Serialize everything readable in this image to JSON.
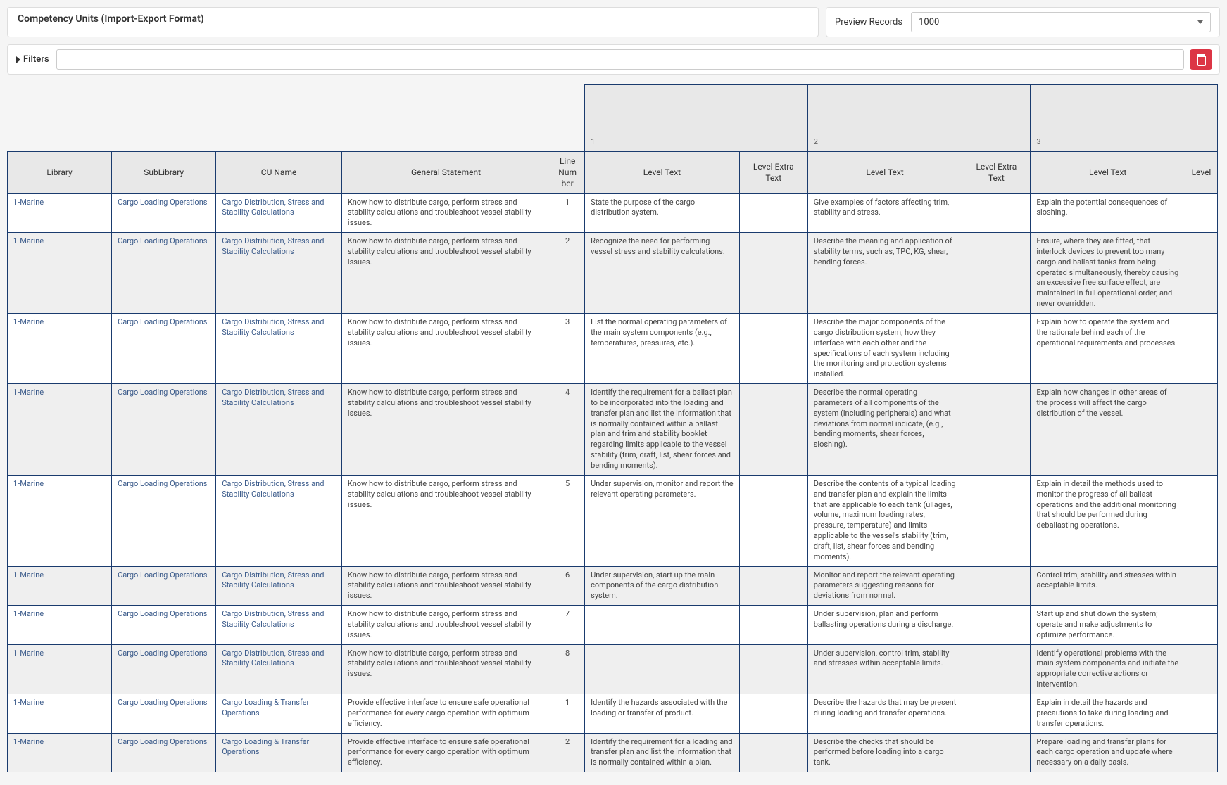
{
  "header": {
    "title": "Competency Units (Import-Export Format)"
  },
  "preview": {
    "label": "Preview Records",
    "value": "1000"
  },
  "filters": {
    "label": "Filters",
    "input_value": ""
  },
  "columns": {
    "library": "Library",
    "sublibrary": "SubLibrary",
    "cu_name": "CU Name",
    "general": "General Statement",
    "line_no": "Line Number",
    "level_text": "Level Text",
    "level_extra": "Level Extra Text",
    "level": "Level"
  },
  "super_headers": [
    "1",
    "2",
    "3"
  ],
  "rows": [
    {
      "lib": "1-Marine",
      "sub": "Cargo Loading Operations",
      "cu": "Cargo Distribution, Stress and Stability Calculations",
      "gen": "Know how to distribute cargo, perform stress and stability calculations and troubleshoot vessel stability issues.",
      "line": "1",
      "l1t": "State the purpose of the cargo distribution system.",
      "l1e": "",
      "l2t": "Give examples of factors affecting trim, stability and stress.",
      "l2e": "",
      "l3t": "Explain the potential consequences of sloshing.",
      "lev": ""
    },
    {
      "lib": "1-Marine",
      "sub": "Cargo Loading Operations",
      "cu": "Cargo Distribution, Stress and Stability Calculations",
      "gen": "Know how to distribute cargo, perform stress and stability calculations and troubleshoot vessel stability issues.",
      "line": "2",
      "l1t": "Recognize the need for performing vessel stress and stability calculations.",
      "l1e": "",
      "l2t": "Describe the meaning and application of stability terms, such as, TPC, KG, shear, bending forces.",
      "l2e": "",
      "l3t": "Ensure, where they are fitted, that interlock devices to prevent too many cargo and ballast tanks from being operated simultaneously, thereby causing an excessive free surface effect, are maintained in full operational order, and never overridden.",
      "lev": ""
    },
    {
      "lib": "1-Marine",
      "sub": "Cargo Loading Operations",
      "cu": "Cargo Distribution, Stress and Stability Calculations",
      "gen": "Know how to distribute cargo, perform stress and stability calculations and troubleshoot vessel stability issues.",
      "line": "3",
      "l1t": "List the normal operating parameters of the main system components (e.g., temperatures, pressures, etc.).",
      "l1e": "",
      "l2t": "Describe the major components of the cargo distribution system, how they interface with each other and the specifications of each system including the monitoring and protection systems installed.",
      "l2e": "",
      "l3t": "Explain how to operate the system and the rationale behind each of the operational requirements and processes.",
      "lev": ""
    },
    {
      "lib": "1-Marine",
      "sub": "Cargo Loading Operations",
      "cu": "Cargo Distribution, Stress and Stability Calculations",
      "gen": "Know how to distribute cargo, perform stress and stability calculations and troubleshoot vessel stability issues.",
      "line": "4",
      "l1t": "Identify the requirement for a ballast plan to be incorporated into the loading and transfer plan and list the information that is normally contained within a ballast plan and trim and stability booklet regarding limits applicable to the vessel stability (trim, draft, list, shear forces and bending moments).",
      "l1e": "",
      "l2t": "Describe the normal operating parameters of all components of the system (including peripherals) and what deviations from normal indicate, (e.g., bending moments, shear forces, sloshing).",
      "l2e": "",
      "l3t": "Explain how changes in other areas of the process will affect the cargo distribution of the vessel.",
      "lev": ""
    },
    {
      "lib": "1-Marine",
      "sub": "Cargo Loading Operations",
      "cu": "Cargo Distribution, Stress and Stability Calculations",
      "gen": "Know how to distribute cargo, perform stress and stability calculations and troubleshoot vessel stability issues.",
      "line": "5",
      "l1t": "Under supervision, monitor and report the relevant operating parameters.",
      "l1e": "",
      "l2t": "Describe the contents of a typical loading and transfer plan and explain the limits that are applicable to each tank (ullages, volume, maximum loading rates, pressure, temperature) and limits applicable to the vessel's stability (trim, draft, list, shear forces and bending moments).",
      "l2e": "",
      "l3t": "Explain in detail the methods used to monitor the progress of all ballast operations and the additional monitoring that should be performed during deballasting operations.",
      "lev": ""
    },
    {
      "lib": "1-Marine",
      "sub": "Cargo Loading Operations",
      "cu": "Cargo Distribution, Stress and Stability Calculations",
      "gen": "Know how to distribute cargo, perform stress and stability calculations and troubleshoot vessel stability issues.",
      "line": "6",
      "l1t": "Under supervision, start up the main components of the cargo distribution system.",
      "l1e": "",
      "l2t": "Monitor and report the relevant operating parameters suggesting reasons for deviations from normal.",
      "l2e": "",
      "l3t": "Control trim, stability and stresses within acceptable limits.",
      "lev": ""
    },
    {
      "lib": "1-Marine",
      "sub": "Cargo Loading Operations",
      "cu": "Cargo Distribution, Stress and Stability Calculations",
      "gen": "Know how to distribute cargo, perform stress and stability calculations and troubleshoot vessel stability issues.",
      "line": "7",
      "l1t": "",
      "l1e": "",
      "l2t": "Under supervision, plan and perform ballasting operations during a discharge.",
      "l2e": "",
      "l3t": "Start up and shut down the system; operate and make adjustments to optimize performance.",
      "lev": ""
    },
    {
      "lib": "1-Marine",
      "sub": "Cargo Loading Operations",
      "cu": "Cargo Distribution, Stress and Stability Calculations",
      "gen": "Know how to distribute cargo, perform stress and stability calculations and troubleshoot vessel stability issues.",
      "line": "8",
      "l1t": "",
      "l1e": "",
      "l2t": "Under supervision, control trim, stability and stresses within acceptable limits.",
      "l2e": "",
      "l3t": "Identify operational problems with the main system components and initiate the appropriate corrective actions or intervention.",
      "lev": ""
    },
    {
      "lib": "1-Marine",
      "sub": "Cargo Loading Operations",
      "cu": "Cargo Loading & Transfer Operations",
      "gen": "Provide effective interface to ensure safe operational performance for every cargo operation with optimum efficiency.",
      "line": "1",
      "l1t": "Identify the hazards associated with the loading or transfer of product.",
      "l1e": "",
      "l2t": "Describe the hazards that may be present during loading and transfer operations.",
      "l2e": "",
      "l3t": "Explain in detail the hazards and precautions to take during loading and transfer operations.",
      "lev": ""
    },
    {
      "lib": "1-Marine",
      "sub": "Cargo Loading Operations",
      "cu": "Cargo Loading & Transfer Operations",
      "gen": "Provide effective interface to ensure safe operational performance for every cargo operation with optimum efficiency.",
      "line": "2",
      "l1t": "Identify the requirement for a loading and transfer plan and list the information that is normally contained within a plan.",
      "l1e": "",
      "l2t": "Describe the checks that should be performed before loading into a cargo tank.",
      "l2e": "",
      "l3t": "Prepare loading and transfer plans for each cargo operation and update where necessary on a daily basis.",
      "lev": ""
    }
  ]
}
